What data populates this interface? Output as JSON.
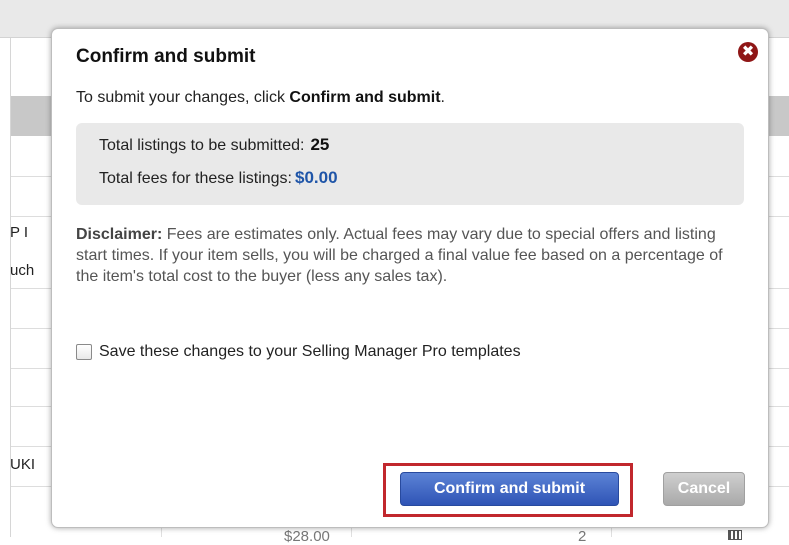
{
  "background": {
    "side_labels": [
      "P I",
      "uch",
      "UKI"
    ],
    "bottom_price": "$28.00",
    "bottom_qty": "2"
  },
  "dialog": {
    "title": "Confirm and submit",
    "instruction_prefix": "To submit your changes, click ",
    "instruction_bold": "Confirm and submit",
    "instruction_suffix": ".",
    "summary": {
      "listings_label": "Total listings to be submitted:",
      "listings_value": "25",
      "fees_label": "Total fees for these listings:",
      "fees_value": "$0.00"
    },
    "disclaimer_label": "Disclaimer:",
    "disclaimer_text": " Fees are estimates only. Actual fees may vary due to special offers and listing start times. If your item sells, you will be charged a final value fee based on a percentage of the item's total cost to the buyer (less any sales tax).",
    "save_checkbox_label": "Save these changes to your Selling Manager Pro templates",
    "save_checkbox_checked": false,
    "confirm_label": "Confirm and submit",
    "cancel_label": "Cancel",
    "close_icon": "close-icon"
  },
  "colors": {
    "accent_blue": "#2f54b6",
    "fee_blue": "#1f55a8",
    "highlight_red": "#c1272d",
    "close_red": "#8f1616"
  }
}
